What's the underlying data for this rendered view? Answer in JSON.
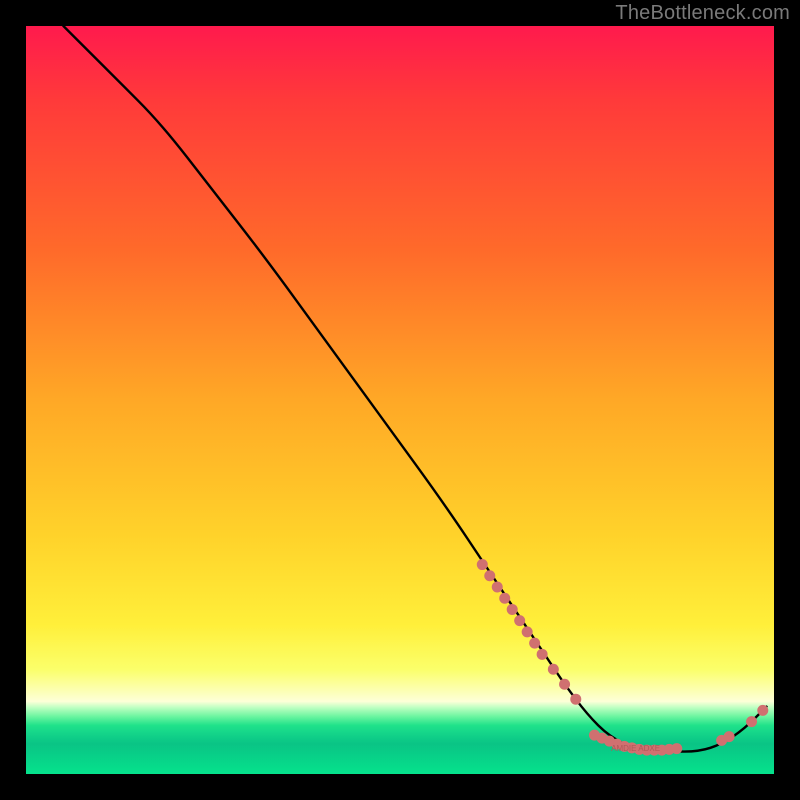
{
  "watermark": "TheBottleneck.com",
  "chart_data": {
    "type": "line",
    "title": "",
    "xlabel": "",
    "ylabel": "",
    "xlim": [
      0,
      100
    ],
    "ylim": [
      0,
      100
    ],
    "grid": false,
    "legend": false,
    "series": [
      {
        "name": "curve",
        "x": [
          5,
          8,
          12,
          18,
          25,
          32,
          40,
          48,
          56,
          62,
          66,
          70,
          72,
          75,
          78,
          82,
          86,
          90,
          93,
          96,
          99
        ],
        "y": [
          100,
          97,
          93,
          87,
          78,
          69,
          58,
          47,
          36,
          27,
          21,
          15,
          12,
          8,
          5,
          3,
          3,
          3,
          4,
          6,
          9
        ]
      }
    ],
    "dot_clusters": [
      {
        "name": "descent-cluster",
        "color": "#d07070",
        "points": [
          {
            "x": 61,
            "y": 28
          },
          {
            "x": 62,
            "y": 26.5
          },
          {
            "x": 63,
            "y": 25
          },
          {
            "x": 64,
            "y": 23.5
          },
          {
            "x": 65,
            "y": 22
          },
          {
            "x": 66,
            "y": 20.5
          },
          {
            "x": 67,
            "y": 19
          },
          {
            "x": 68,
            "y": 17.5
          },
          {
            "x": 69,
            "y": 16
          },
          {
            "x": 70.5,
            "y": 14
          },
          {
            "x": 72,
            "y": 12
          },
          {
            "x": 73.5,
            "y": 10
          }
        ]
      },
      {
        "name": "valley-cluster",
        "color": "#d07070",
        "points": [
          {
            "x": 76,
            "y": 5.2
          },
          {
            "x": 77,
            "y": 4.8
          },
          {
            "x": 78,
            "y": 4.4
          },
          {
            "x": 79,
            "y": 4.0
          },
          {
            "x": 80,
            "y": 3.7
          },
          {
            "x": 81,
            "y": 3.5
          },
          {
            "x": 82,
            "y": 3.3
          },
          {
            "x": 83,
            "y": 3.2
          },
          {
            "x": 84,
            "y": 3.2
          },
          {
            "x": 85,
            "y": 3.2
          },
          {
            "x": 86,
            "y": 3.3
          },
          {
            "x": 87,
            "y": 3.4
          }
        ]
      },
      {
        "name": "rise-cluster",
        "color": "#d07070",
        "points": [
          {
            "x": 93,
            "y": 4.5
          },
          {
            "x": 94,
            "y": 5.0
          },
          {
            "x": 97,
            "y": 7.0
          },
          {
            "x": 98.5,
            "y": 8.5
          }
        ]
      }
    ],
    "annotations": [
      {
        "text": "AMDIE ADXE",
        "x": 81.5,
        "y": 3.1
      }
    ]
  }
}
